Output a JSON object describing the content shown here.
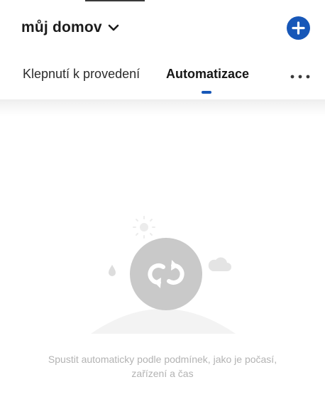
{
  "header": {
    "home_title": "můj domov",
    "add_button_label": "+"
  },
  "tabs": [
    {
      "label": "Klepnutí k provedení",
      "active": false
    },
    {
      "label": "Automatizace",
      "active": true
    }
  ],
  "more_menu_label": "•••",
  "empty_state": {
    "line1": "Spustit automaticky podle podmínek, jako je počasí,",
    "line2": "zařízení a čas"
  },
  "icons": {
    "home_dropdown": "chevron-down-icon",
    "add": "plus-icon",
    "more": "more-dots-icon",
    "empty_illustration": "automation-loop-icon",
    "sun": "sun-icon",
    "cloud": "cloud-icon",
    "raindrop": "raindrop-icon"
  },
  "colors": {
    "accent": "#1757b8",
    "title_text": "#1c1c1c",
    "muted_text": "#b3b3b3",
    "illustration_circle": "#c9c9c9"
  }
}
